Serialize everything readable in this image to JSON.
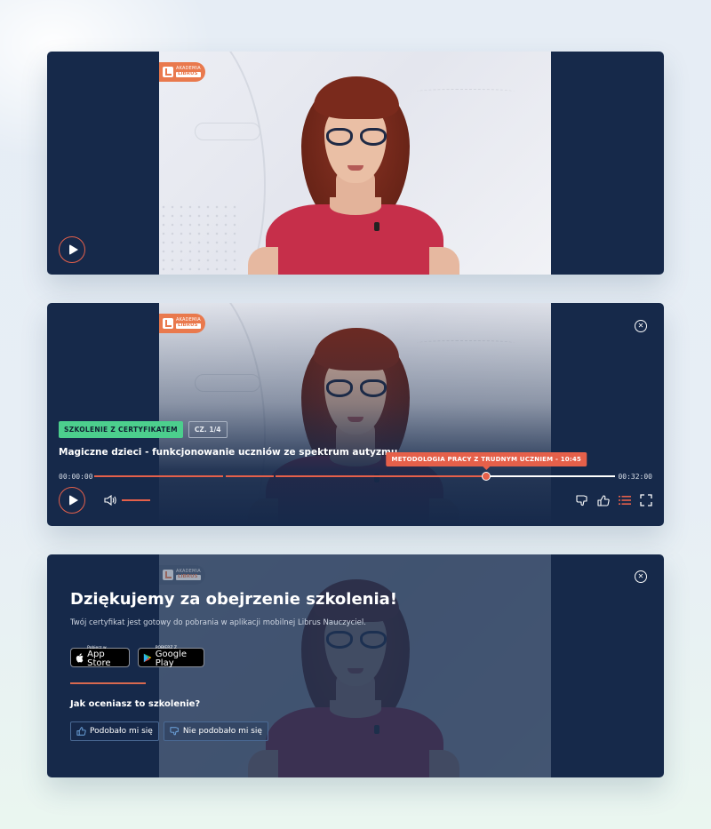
{
  "brand": {
    "logo_top": "AKADEMIA",
    "logo_bottom": "LIBRUS",
    "accent_color": "#e5604a",
    "navy_color": "#16294a",
    "certificate_badge_color": "#4ccf8d"
  },
  "player_idle": {
    "play_icon": "play-icon"
  },
  "player_controls": {
    "badge_certificate": "SZKOLENIE Z CERTYFIKATEM",
    "badge_part": "CZ. 1/4",
    "course_title": "Magiczne dzieci - funkcjonowanie uczniów ze spektrum autyzmu",
    "current_time": "00:00:00",
    "total_time": "00:32:00",
    "progress_fraction": 0.753,
    "chapter_markers_fraction": [
      0.25,
      0.346
    ],
    "chapter_tooltip": "METODOLOGIA PRACY Z TRUDNYM UCZNIEM - 10:45",
    "volume_fraction": 1.0,
    "icons": [
      "close-icon",
      "play-icon",
      "volume-icon",
      "thumbs-down-icon",
      "thumbs-up-icon",
      "chapters-list-icon",
      "fullscreen-icon"
    ]
  },
  "end_screen": {
    "title": "Dziękujemy za obejrzenie szkolenia!",
    "subtitle": "Twój certyfikat jest gotowy do pobrania w aplikacji mobilnej Librus Nauczyciel.",
    "app_store": {
      "small": "Pobierz w",
      "big": "App Store"
    },
    "google_play": {
      "small": "POBIERZ Z",
      "big": "Google Play"
    },
    "rating_question": "Jak oceniasz to szkolenie?",
    "like_label": "Podobało mi się",
    "dislike_label": "Nie podobało mi się"
  }
}
